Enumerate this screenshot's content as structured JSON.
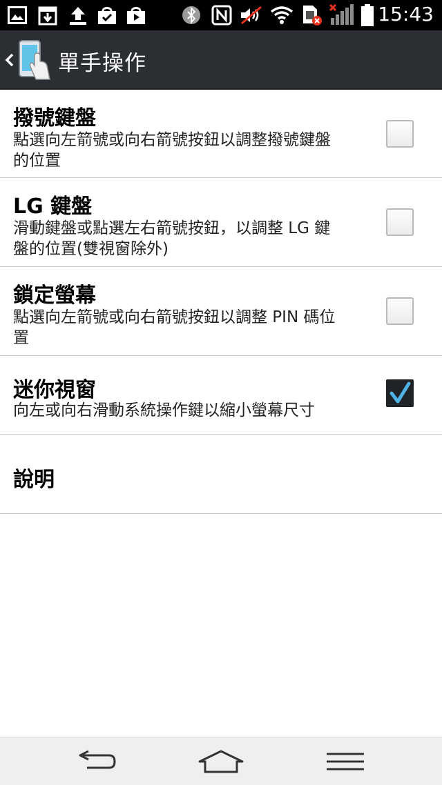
{
  "status_bar": {
    "time": "15:43",
    "icons": [
      "gallery-icon",
      "download-box-icon",
      "upload-icon",
      "shopping-bag-icon",
      "play-store-icon",
      "bluetooth-icon",
      "nfc-icon",
      "muted-volume-icon",
      "wifi-icon",
      "sim-error-icon",
      "signal-no-service-icon",
      "battery-icon"
    ]
  },
  "action_bar": {
    "title": "單手操作",
    "back_icon": "chevron-left-icon",
    "app_icon": "one-hand-phone-icon"
  },
  "settings": [
    {
      "title": "撥號鍵盤",
      "summary_lines": [
        "點選向左箭號或向右箭號按鈕以調整撥號鍵盤",
        "的位置"
      ],
      "checked": false
    },
    {
      "title": "LG 鍵盤",
      "summary_lines": [
        "滑動鍵盤或點選左右箭號按鈕，以調整 LG 鍵",
        "盤的位置(雙視窗除外)"
      ],
      "checked": false
    },
    {
      "title": "鎖定螢幕",
      "summary_lines": [
        "點選向左箭號或向右箭號按鈕以調整 PIN 碼位",
        "置"
      ],
      "checked": false
    },
    {
      "title": "迷你視窗",
      "summary_lines": [
        "向左或向右滑動系統操作鍵以縮小螢幕尺寸"
      ],
      "checked": true
    },
    {
      "title": "說明",
      "summary_lines": [],
      "checked": null
    }
  ],
  "nav_bar": {
    "buttons": [
      "back-arrow-icon",
      "home-icon",
      "menu-icon"
    ]
  }
}
